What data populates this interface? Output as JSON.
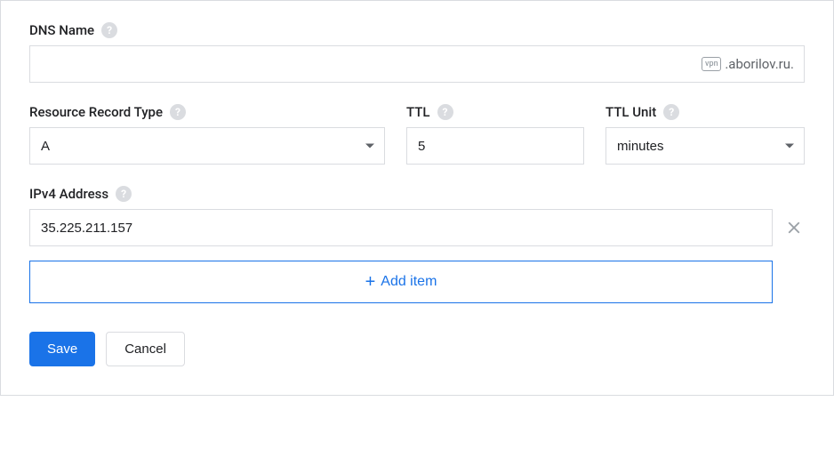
{
  "dns_name": {
    "label": "DNS Name",
    "value": "",
    "suffix_hint": "vpn",
    "suffix": ".aborilov.ru."
  },
  "record_type": {
    "label": "Resource Record Type",
    "value": "A"
  },
  "ttl": {
    "label": "TTL",
    "value": "5"
  },
  "ttl_unit": {
    "label": "TTL Unit",
    "value": "minutes"
  },
  "ipv4": {
    "label": "IPv4 Address",
    "value": "35.225.211.157"
  },
  "buttons": {
    "add_item": "Add item",
    "save": "Save",
    "cancel": "Cancel"
  }
}
